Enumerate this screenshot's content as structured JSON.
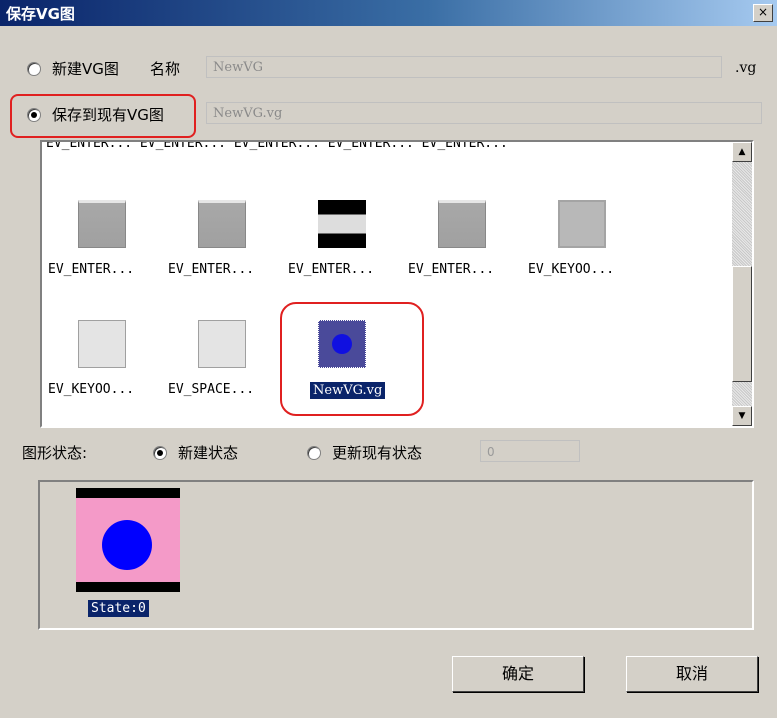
{
  "window": {
    "title": "保存VG图",
    "close_glyph": "×"
  },
  "options": {
    "new_vg": {
      "label": "新建VG图",
      "name_label": "名称",
      "name_value": "NewVG",
      "suffix": ".vg"
    },
    "existing_vg": {
      "label": "保存到现有VG图",
      "value": "NewVG.vg"
    }
  },
  "list": {
    "clipped_row": "EV_ENTER...  EV_ENTER...  EV_ENTER...  EV_ENTER...  EV_ENTER...",
    "items": [
      {
        "label": "EV_ENTER...",
        "icon": "gray-button-thumbnail"
      },
      {
        "label": "EV_ENTER...",
        "icon": "gray-button-thumbnail"
      },
      {
        "label": "EV_ENTER...",
        "icon": "black-bars-thumbnail"
      },
      {
        "label": "EV_ENTER...",
        "icon": "gray-button-thumbnail"
      },
      {
        "label": "EV_KEYOO...",
        "icon": "gray-flat-thumbnail"
      },
      {
        "label": "EV_KEYOO...",
        "icon": "light-button-thumbnail"
      },
      {
        "label": "EV_SPACE...",
        "icon": "light-button-thumbnail"
      },
      {
        "label": "NewVG.vg",
        "icon": "blue-circle-thumbnail",
        "selected": true
      }
    ],
    "scroll_up": "▲",
    "scroll_down": "▼"
  },
  "state": {
    "label": "图形状态:",
    "new_state": "新建状态",
    "update_state": "更新现有状态",
    "update_value": "0",
    "preview_label": "State:0"
  },
  "buttons": {
    "ok": "确定",
    "cancel": "取消"
  },
  "colors": {
    "title_start": "#0a246a",
    "highlight": "#e02020",
    "state_bg": "#f49ac8",
    "state_dot": "#0000ff"
  }
}
